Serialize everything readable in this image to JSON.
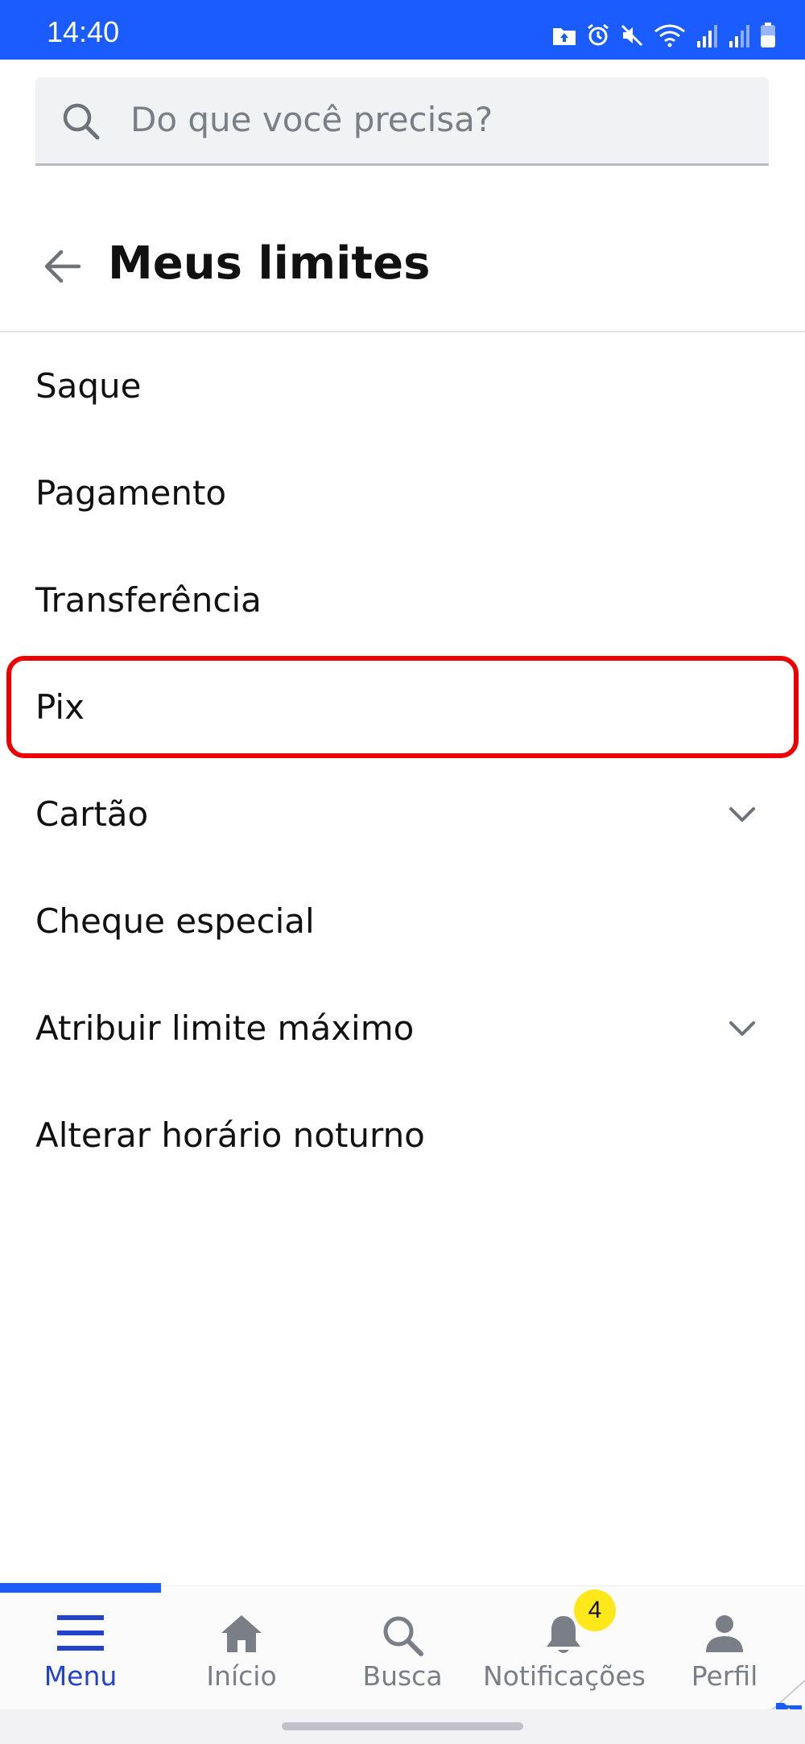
{
  "status_bar": {
    "time": "14:40",
    "icons": [
      "folder-upload-icon",
      "alarm-icon",
      "mute-icon",
      "wifi-icon",
      "signal-icon",
      "signal-icon-2",
      "battery-icon"
    ]
  },
  "search": {
    "placeholder": "Do que você precisa?",
    "value": ""
  },
  "header": {
    "title": "Meus limites",
    "back_icon": "arrow-left-icon"
  },
  "menu": {
    "items": [
      {
        "label": "Saque",
        "expandable": false
      },
      {
        "label": "Pagamento",
        "expandable": false
      },
      {
        "label": "Transferência",
        "expandable": false
      },
      {
        "label": "Pix",
        "expandable": false,
        "highlighted": true
      },
      {
        "label": "Cartão",
        "expandable": true
      },
      {
        "label": "Cheque especial",
        "expandable": false
      },
      {
        "label": "Atribuir limite máximo",
        "expandable": true
      },
      {
        "label": "Alterar horário noturno",
        "expandable": false
      }
    ]
  },
  "bottom_nav": {
    "items": [
      {
        "label": "Menu",
        "icon": "hamburger-icon",
        "active": true
      },
      {
        "label": "Início",
        "icon": "home-icon",
        "active": false
      },
      {
        "label": "Busca",
        "icon": "search-icon",
        "active": false
      },
      {
        "label": "Notificações",
        "icon": "bell-icon",
        "active": false,
        "badge": "4"
      },
      {
        "label": "Perfil",
        "icon": "person-icon",
        "active": false
      }
    ]
  },
  "colors": {
    "brand": "#1a5cff",
    "highlight_border": "#ee0000",
    "badge": "#ffe81a",
    "active_nav": "#2244cc",
    "muted": "#7a7e86"
  }
}
